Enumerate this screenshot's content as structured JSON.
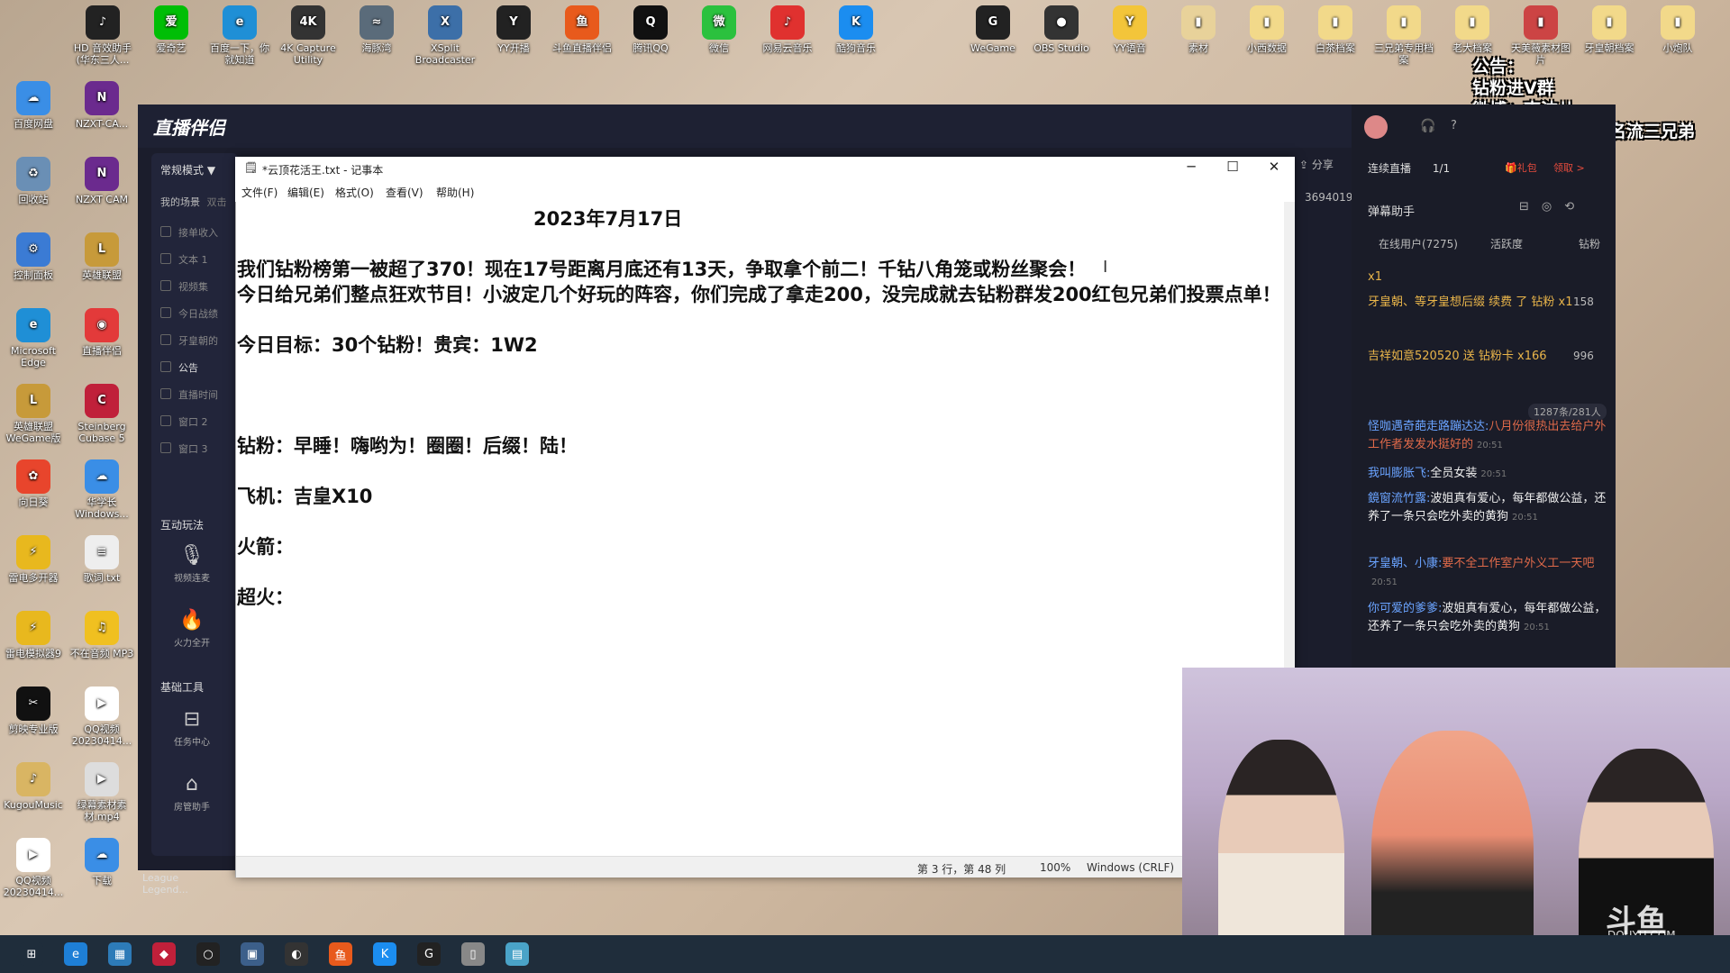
{
  "desktop_icons_left": [
    {
      "label": "百度网盘",
      "color": "#3a8ee6",
      "glyph": "☁"
    },
    {
      "label": "回收站",
      "color": "#6a8fb5",
      "glyph": "♻"
    },
    {
      "label": "控制面板",
      "color": "#3b7bd4",
      "glyph": "⚙"
    },
    {
      "label": "Microsoft Edge",
      "color": "#1f8fd6",
      "glyph": "e"
    },
    {
      "label": "英雄联盟 WeGame版",
      "color": "#c79a3a",
      "glyph": "L"
    },
    {
      "label": "向日葵",
      "color": "#e8452c",
      "glyph": "✿"
    },
    {
      "label": "雷电多开器",
      "color": "#e8b81e",
      "glyph": "⚡"
    },
    {
      "label": "雷电模拟器9",
      "color": "#e8b81e",
      "glyph": "⚡"
    },
    {
      "label": "剪映专业版",
      "color": "#111111",
      "glyph": "✂"
    },
    {
      "label": "KugouMusic",
      "color": "#d9b563",
      "glyph": "♪"
    },
    {
      "label": "QQ视频 20230414...",
      "color": "#ffffff",
      "glyph": "▶"
    }
  ],
  "desktop_icons_left2": [
    {
      "label": "NZXT-CA...",
      "color": "#6b2a8e",
      "glyph": "N"
    },
    {
      "label": "NZXT CAM",
      "color": "#6b2a8e",
      "glyph": "N"
    },
    {
      "label": "英雄联盟",
      "color": "#c79a3a",
      "glyph": "L"
    },
    {
      "label": "直播伴侣",
      "color": "#e33a3a",
      "glyph": "◉"
    },
    {
      "label": "Steinberg Cubase 5",
      "color": "#c0203a",
      "glyph": "C"
    },
    {
      "label": "华学长 Windows...",
      "color": "#3a8ee6",
      "glyph": "☁"
    },
    {
      "label": "歌词.txt",
      "color": "#eeeeee",
      "glyph": "≡"
    },
    {
      "label": "不在音频 MP3",
      "color": "#f0c020",
      "glyph": "♫"
    },
    {
      "label": "QQ视频 20230414...",
      "color": "#ffffff",
      "glyph": "▶"
    },
    {
      "label": "绿幕素材素材.mp4",
      "color": "#dddddd",
      "glyph": "▶"
    },
    {
      "label": "下载",
      "color": "#3a8ee6",
      "glyph": "☁"
    }
  ],
  "desktop_icons_top": [
    {
      "label": "HD 音效助手 (华东三人...",
      "color": "#222222",
      "glyph": "♪"
    },
    {
      "label": "爱奇艺",
      "color": "#00be06",
      "glyph": "爱"
    },
    {
      "label": "百度一下，你就知道",
      "color": "#1f8fd6",
      "glyph": "e"
    },
    {
      "label": "4K Capture Utility",
      "color": "#333333",
      "glyph": "4K"
    },
    {
      "label": "海豚湾",
      "color": "#5a6b7a",
      "glyph": "≈"
    },
    {
      "label": "XSplit Broadcaster",
      "color": "#3c6fa8",
      "glyph": "X"
    },
    {
      "label": "YY开播",
      "color": "#222222",
      "glyph": "Y"
    },
    {
      "label": "斗鱼直播伴侣",
      "color": "#e85a1c",
      "glyph": "鱼"
    },
    {
      "label": "腾讯QQ",
      "color": "#111111",
      "glyph": "Q"
    },
    {
      "label": "微信",
      "color": "#2bc13e",
      "glyph": "微"
    },
    {
      "label": "网易云音乐",
      "color": "#e0312f",
      "glyph": "♪"
    },
    {
      "label": "酷狗音乐",
      "color": "#1b8df0",
      "glyph": "K"
    }
  ],
  "desktop_icons_top_right": [
    {
      "label": "WeGame",
      "color": "#222222",
      "glyph": "G"
    },
    {
      "label": "OBS Studio",
      "color": "#333333",
      "glyph": "●"
    },
    {
      "label": "YY语音",
      "color": "#f3c53a",
      "glyph": "Y"
    },
    {
      "label": "素材",
      "color": "#e8d29a",
      "glyph": "▮"
    },
    {
      "label": "小西数据",
      "color": "#f2d98a",
      "glyph": "▮"
    },
    {
      "label": "白茶档案",
      "color": "#f2d98a",
      "glyph": "▮"
    },
    {
      "label": "三兄弟专用档案",
      "color": "#f2d98a",
      "glyph": "▮"
    },
    {
      "label": "老大档案",
      "color": "#f2d98a",
      "glyph": "▮"
    },
    {
      "label": "天美薇素材图片",
      "color": "#c44",
      "glyph": "▮"
    },
    {
      "label": "牙皇朝档案",
      "color": "#f2d98a",
      "glyph": "▮"
    },
    {
      "label": "小炮队",
      "color": "#f2d98a",
      "glyph": "▮"
    }
  ],
  "announcement": [
    "公告：",
    "钻粉进V群",
    "微博：南波儿",
    "视频教学搜：云顶名流三兄弟"
  ],
  "app": {
    "logo": "直播伴侣",
    "mode": "常规模式 ▼",
    "my_scene": "我的场景",
    "double_click": "双击",
    "scene_items": [
      "接单收入",
      "文本 1",
      "视频集",
      "今日战绩",
      "牙皇朝的",
      "公告",
      "直播时间",
      "窗口 2",
      "窗口 3"
    ],
    "interactive_title": "互动玩法",
    "tools1": [
      {
        "label": "视频连麦",
        "glyph": "🎙"
      },
      {
        "label": "火力全开",
        "glyph": "🔥"
      }
    ],
    "basic_tools_title": "基础工具",
    "tools2": [
      {
        "label": "任务中心",
        "glyph": "⊟"
      },
      {
        "label": "房管助手",
        "glyph": "⌂"
      }
    ],
    "share": "分享",
    "room_number": "3694019",
    "bottom_label": "League Legend..."
  },
  "chat": {
    "continuous": "连续直播",
    "count": "1/1",
    "gift": "礼包",
    "claim": "领取 >",
    "assistant": "弹幕助手",
    "tabs": [
      "在线用户(7275)",
      "活跃度",
      "钻粉"
    ],
    "gift_rows": [
      {
        "text": "x1",
        "score": ""
      },
      {
        "text": "牙皇朝、等牙皇想后缀 续费 了 钻粉 x1",
        "score": "158"
      },
      {
        "text": "吉祥如意520520 送 钻粉卡 x166",
        "score": "996"
      }
    ],
    "viewer_count": "1287条/281人",
    "messages": [
      {
        "name": "怪咖遇奇葩走路蹦达达:",
        "text": "八月份很热出去给户外工作者发发水挺好的",
        "time": "20:51"
      },
      {
        "name": "我叫膨胀飞:",
        "text": "全员女装",
        "time": "20:51"
      },
      {
        "name": "鏡窗流竹露:",
        "text": "波姐真有爱心，每年都做公益，还养了一条只会吃外卖的黄狗",
        "time": "20:51"
      },
      {
        "name": "牙皇朝、小康:",
        "text": "要不全工作室户外义工一天吧",
        "time": "20:51"
      },
      {
        "name": "你可爱的爹爹:",
        "text": "波姐真有爱心，每年都做公益，还养了一条只会吃外卖的黄狗",
        "time": "20:51"
      }
    ]
  },
  "notepad": {
    "title": "*云顶花活王.txt - 记事本",
    "menu": [
      "文件(F)",
      "编辑(E)",
      "格式(O)",
      "查看(V)",
      "帮助(H)"
    ],
    "lines": [
      "                                             2023年7月17日",
      "",
      "我们钻粉榜第一被超了370！现在17号距离月底还有13天，争取拿个前二！千钻八角笼或粉丝聚会！",
      "今日给兄弟们整点狂欢节目！小波定几个好玩的阵容，你们完成了拿走200，没完成就去钻粉群发200红包兄弟们投票点单！",
      "",
      "今日目标：30个钻粉！贵宾：1W2",
      "",
      "",
      "",
      "钻粉：早睡！嗨哟为！圈圈！后缀！陆！",
      "",
      "飞机：吉皇X10",
      "",
      "火箭：",
      "",
      "超火："
    ],
    "status": {
      "position": "第 3 行，第 48 列",
      "zoom": "100%",
      "encoding": "Windows (CRLF)"
    }
  },
  "watermark": "DOUYU.COM",
  "watermark_logo": "斗鱼",
  "taskbar_icons": [
    "⊞",
    "e",
    "▦",
    "◆",
    "○",
    "▣",
    "◐",
    "鱼",
    "K",
    "G",
    "▯",
    "▤"
  ]
}
